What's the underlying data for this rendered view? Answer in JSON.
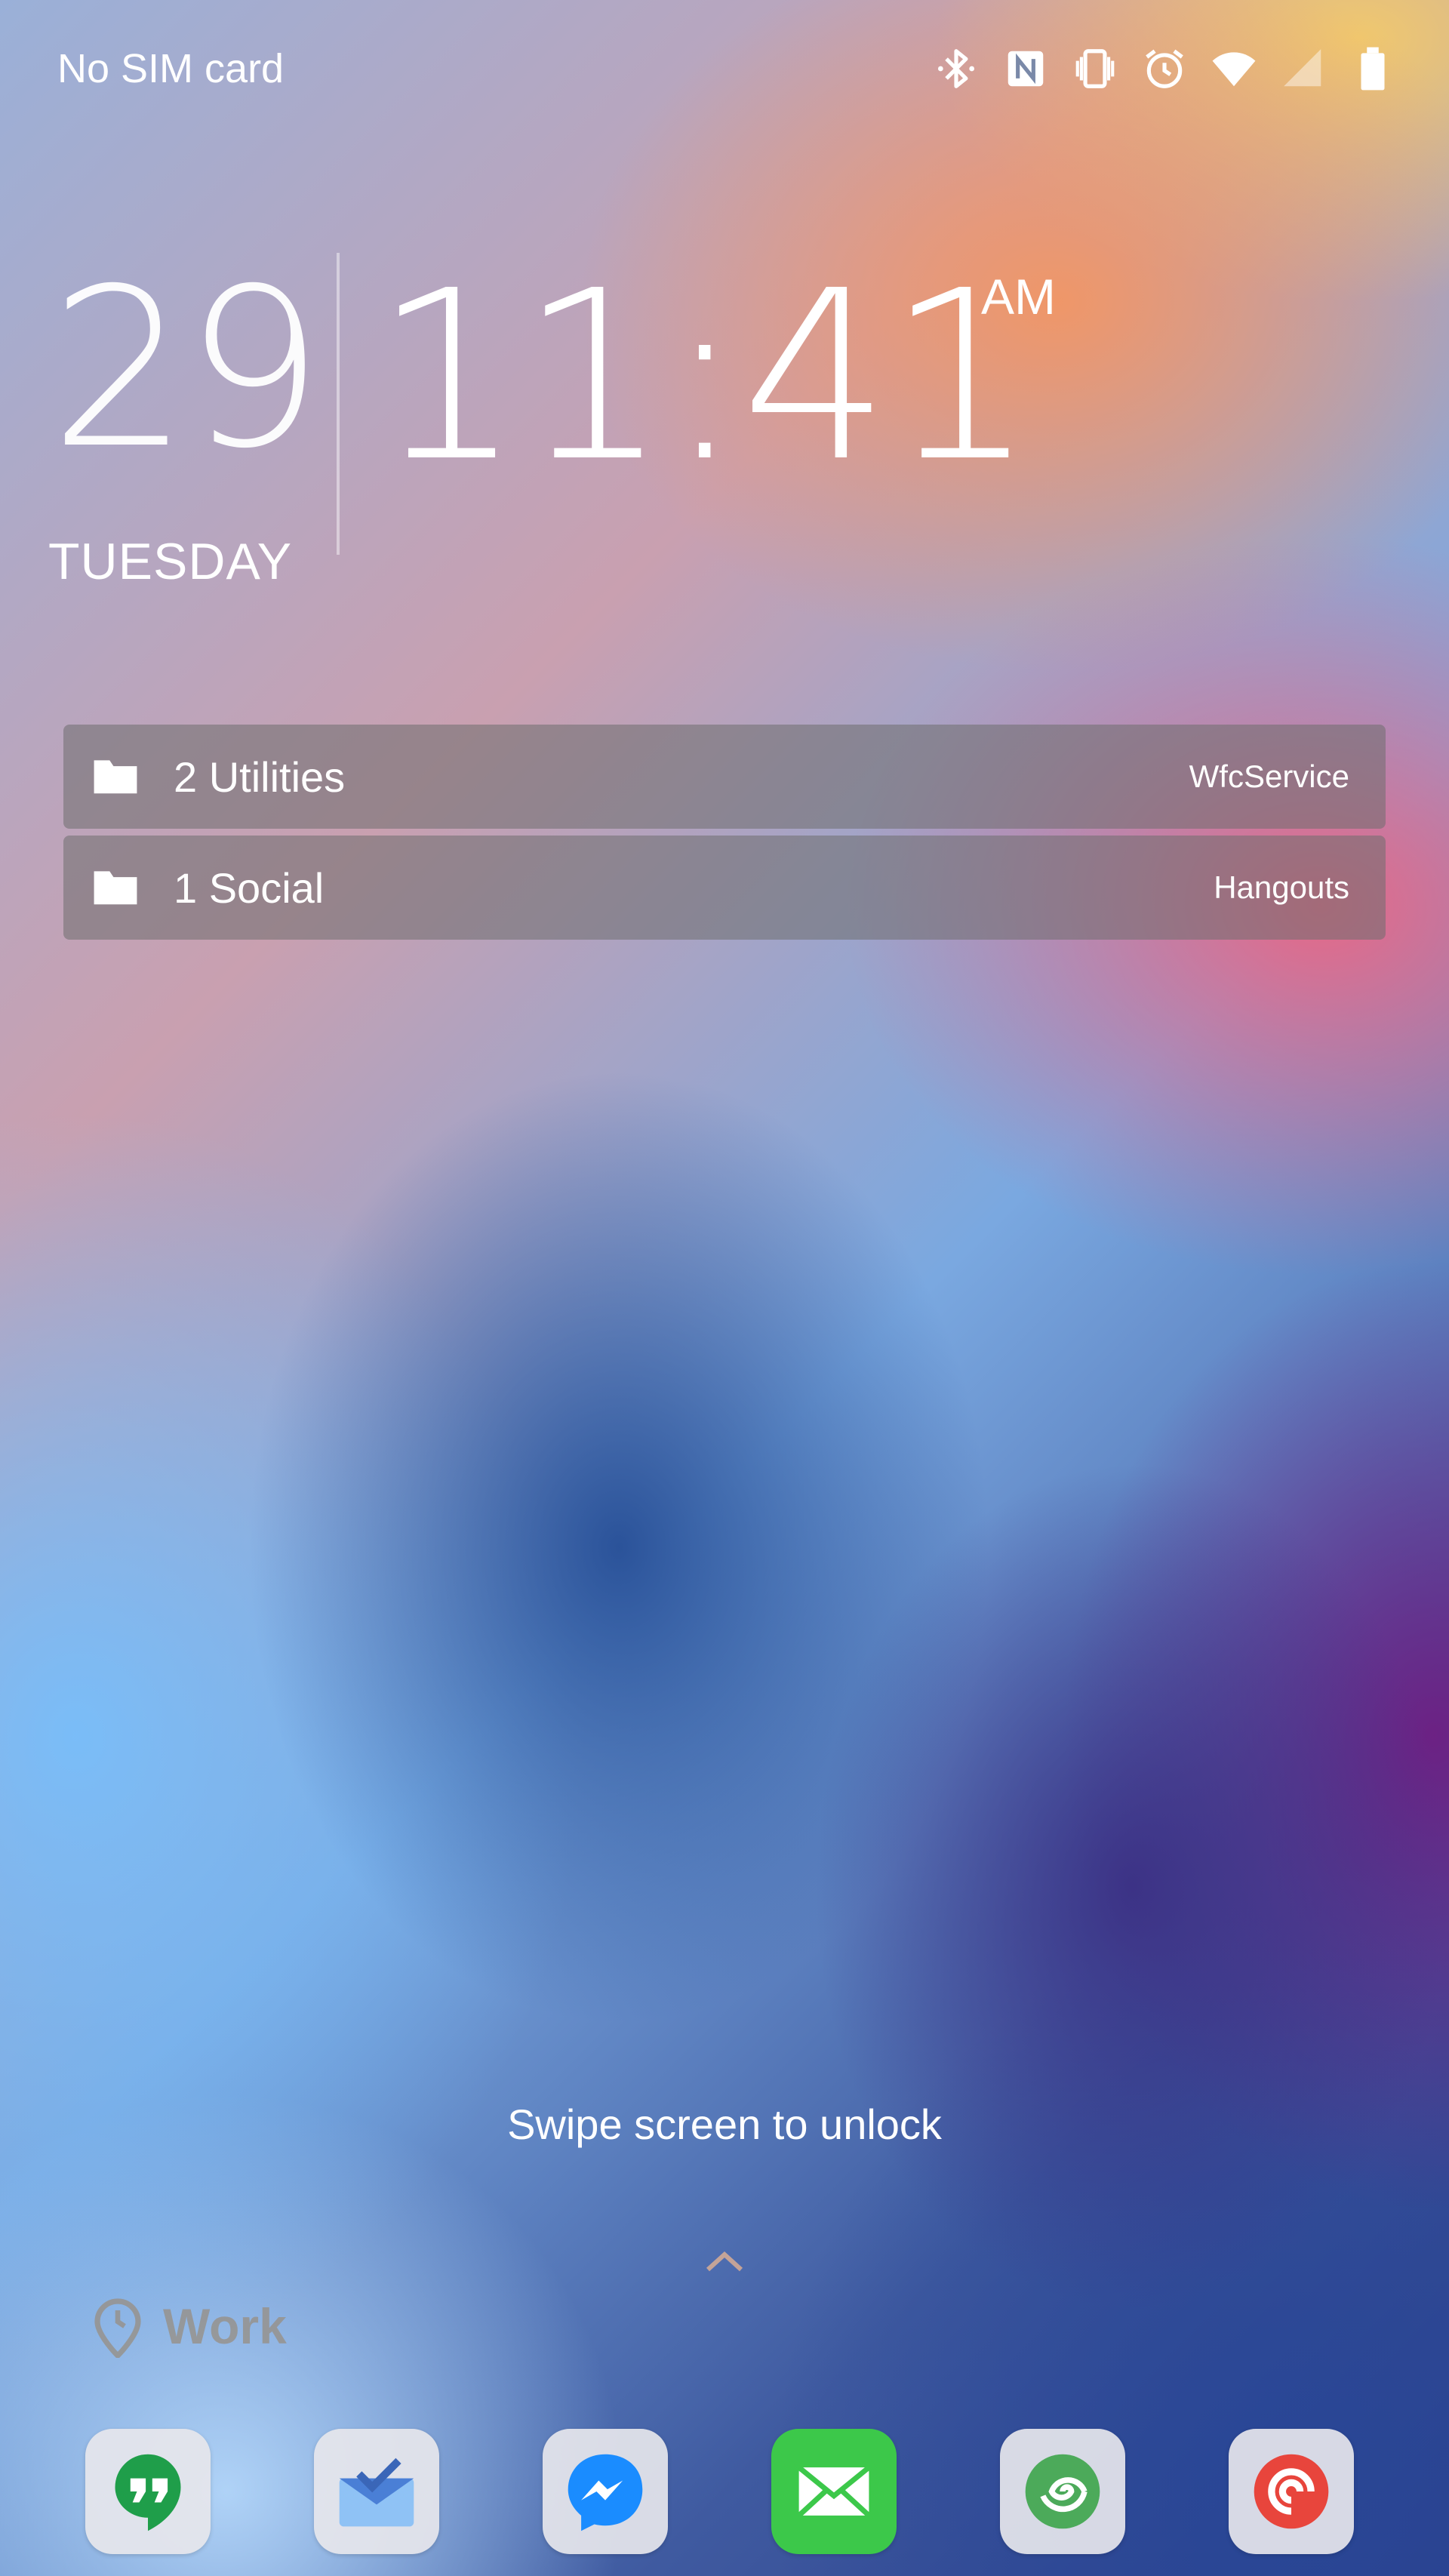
{
  "status_bar": {
    "carrier": "No SIM card",
    "icons": [
      "bluetooth-icon",
      "nfc-icon",
      "vibrate-icon",
      "alarm-icon",
      "wifi-icon",
      "cellular-signal-icon",
      "battery-icon"
    ]
  },
  "clock": {
    "day_number": "29",
    "weekday": "TUESDAY",
    "time": "11:41",
    "ampm": "AM"
  },
  "notifications": [
    {
      "title": "2 Utilities",
      "app": "WfcService",
      "icon": "folder-icon"
    },
    {
      "title": "1 Social",
      "app": "Hangouts",
      "icon": "folder-icon"
    }
  ],
  "lock": {
    "hint": "Swipe screen to unlock",
    "icon": "chevron-up-icon"
  },
  "profile": {
    "label": "Work",
    "icon": "location-clock-icon"
  },
  "dock": {
    "apps": [
      {
        "name": "Hangouts",
        "icon": "hangouts-icon",
        "color": "#1f9e4a"
      },
      {
        "name": "Inbox",
        "icon": "inbox-icon",
        "color": "#4a7fd6"
      },
      {
        "name": "Messenger",
        "icon": "messenger-icon",
        "color": "#1a8cff"
      },
      {
        "name": "Messages",
        "icon": "messages-icon",
        "color": "#3cc84a"
      },
      {
        "name": "Spiral",
        "icon": "spiral-icon",
        "color": "#4caa5a"
      },
      {
        "name": "Pocket Casts",
        "icon": "pocket-casts-icon",
        "color": "#e8453c"
      }
    ]
  }
}
